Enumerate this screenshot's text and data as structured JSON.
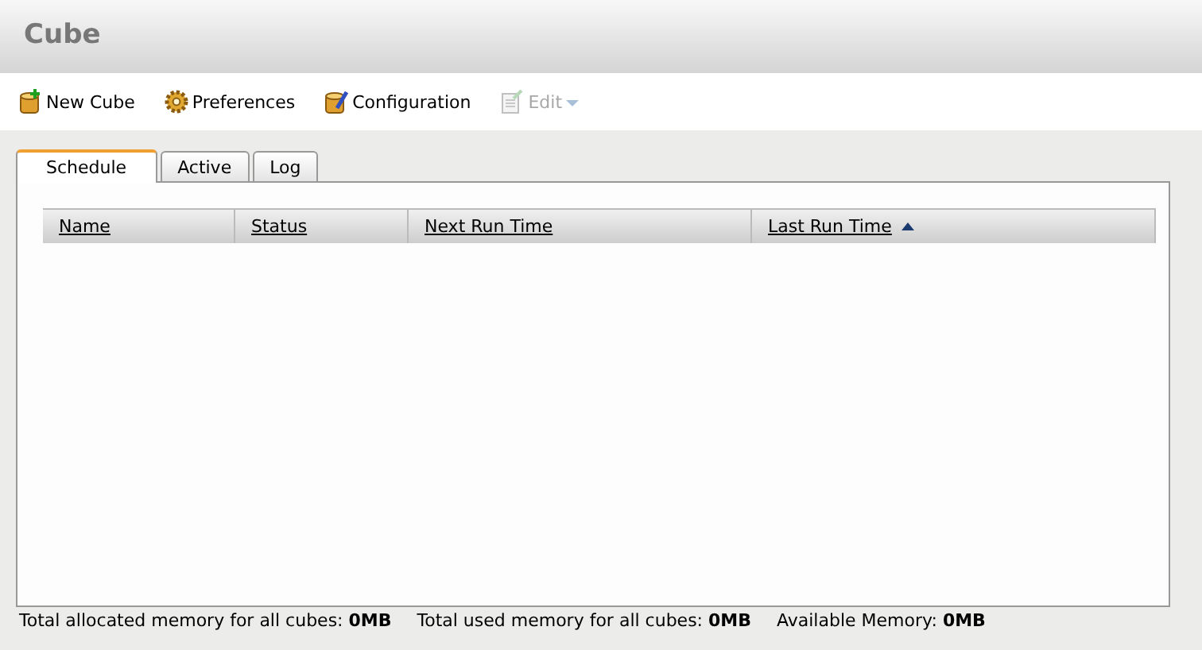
{
  "window": {
    "title": "Cube"
  },
  "toolbar": [
    {
      "label": "New Cube",
      "kind": "button",
      "disabled": false
    },
    {
      "label": "Preferences",
      "kind": "button",
      "disabled": false
    },
    {
      "label": "Configuration",
      "kind": "button",
      "disabled": false
    },
    {
      "label": "Edit",
      "kind": "dropdown",
      "disabled": true
    }
  ],
  "tabs": [
    {
      "label": "Schedule",
      "selected": true
    },
    {
      "label": "Active",
      "selected": false
    },
    {
      "label": "Log",
      "selected": false
    }
  ],
  "table": {
    "columns": [
      {
        "label": "Name",
        "sorted_ascending": false
      },
      {
        "label": "Status",
        "sorted_ascending": false
      },
      {
        "label": "Next Run Time",
        "sorted_ascending": false
      },
      {
        "label": "Last Run Time",
        "sorted_ascending": true
      }
    ]
  },
  "status_bar": [
    "Total allocated memory for all cubes: **0MB**",
    "Total used memory for all cubes: **0MB**",
    "Available Memory: **0MB**"
  ]
}
